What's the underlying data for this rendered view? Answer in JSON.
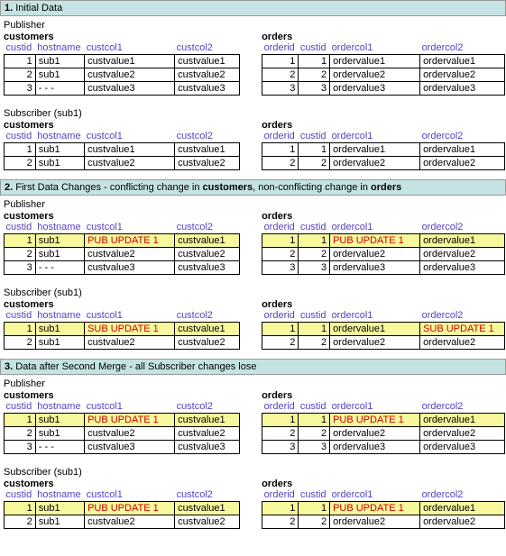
{
  "sections": [
    {
      "num": "1.",
      "title": "Initial Data",
      "roles": [
        {
          "label": "Publisher",
          "customers": {
            "title": "customers",
            "headers": [
              "custid",
              "hostname",
              "custcol1",
              "custcol2"
            ],
            "rows": [
              {
                "c": [
                  "1",
                  "sub1",
                  "custvalue1",
                  "custvalue1"
                ]
              },
              {
                "c": [
                  "2",
                  "sub1",
                  "custvalue2",
                  "custvalue2"
                ]
              },
              {
                "c": [
                  "3",
                  "- - -",
                  "custvalue3",
                  "custvalue3"
                ]
              }
            ]
          },
          "orders": {
            "title": "orders",
            "headers": [
              "orderid",
              "custid",
              "ordercol1",
              "ordercol2"
            ],
            "rows": [
              {
                "c": [
                  "1",
                  "1",
                  "ordervalue1",
                  "ordervalue1"
                ]
              },
              {
                "c": [
                  "2",
                  "2",
                  "ordervalue2",
                  "ordervalue2"
                ]
              },
              {
                "c": [
                  "3",
                  "3",
                  "ordervalue3",
                  "ordervalue3"
                ]
              }
            ]
          }
        },
        {
          "label": "Subscriber (sub1)",
          "customers": {
            "title": "customers",
            "headers": [
              "custid",
              "hostname",
              "custcol1",
              "custcol2"
            ],
            "rows": [
              {
                "c": [
                  "1",
                  "sub1",
                  "custvalue1",
                  "custvalue1"
                ]
              },
              {
                "c": [
                  "2",
                  "sub1",
                  "custvalue2",
                  "custvalue2"
                ]
              }
            ]
          },
          "orders": {
            "title": "orders",
            "headers": [
              "orderid",
              "custid",
              "ordercol1",
              "ordercol2"
            ],
            "rows": [
              {
                "c": [
                  "1",
                  "1",
                  "ordervalue1",
                  "ordervalue1"
                ]
              },
              {
                "c": [
                  "2",
                  "2",
                  "ordervalue2",
                  "ordervalue2"
                ]
              }
            ]
          }
        }
      ]
    },
    {
      "num": "2.",
      "title_html": "First Data Changes - conflicting change in <b>customers</b>, non-conflicting change in <b>orders</b>",
      "roles": [
        {
          "label": "Publisher",
          "customers": {
            "title": "customers",
            "headers": [
              "custid",
              "hostname",
              "custcol1",
              "custcol2"
            ],
            "rows": [
              {
                "c": [
                  "1",
                  "sub1",
                  "PUB UPDATE 1",
                  "custvalue1"
                ],
                "hl": true,
                "upd": [
                  2
                ]
              },
              {
                "c": [
                  "2",
                  "sub1",
                  "custvalue2",
                  "custvalue2"
                ]
              },
              {
                "c": [
                  "3",
                  "- - -",
                  "custvalue3",
                  "custvalue3"
                ]
              }
            ]
          },
          "orders": {
            "title": "orders",
            "headers": [
              "orderid",
              "custid",
              "ordercol1",
              "ordercol2"
            ],
            "rows": [
              {
                "c": [
                  "1",
                  "1",
                  "PUB UPDATE 1",
                  "ordervalue1"
                ],
                "hl": true,
                "upd": [
                  2
                ]
              },
              {
                "c": [
                  "2",
                  "2",
                  "ordervalue2",
                  "ordervalue2"
                ]
              },
              {
                "c": [
                  "3",
                  "3",
                  "ordervalue3",
                  "ordervalue3"
                ]
              }
            ]
          }
        },
        {
          "label": "Subscriber (sub1)",
          "customers": {
            "title": "customers",
            "headers": [
              "custid",
              "hostname",
              "custcol1",
              "custcol2"
            ],
            "rows": [
              {
                "c": [
                  "1",
                  "sub1",
                  "SUB UPDATE 1",
                  "custvalue1"
                ],
                "hl": true,
                "upd": [
                  2
                ]
              },
              {
                "c": [
                  "2",
                  "sub1",
                  "custvalue2",
                  "custvalue2"
                ]
              }
            ]
          },
          "orders": {
            "title": "orders",
            "headers": [
              "orderid",
              "custid",
              "ordercol1",
              "ordercol2"
            ],
            "rows": [
              {
                "c": [
                  "1",
                  "1",
                  "ordervalue1",
                  "SUB UPDATE 1"
                ],
                "hl": true,
                "upd": [
                  3
                ]
              },
              {
                "c": [
                  "2",
                  "2",
                  "ordervalue2",
                  "ordervalue2"
                ]
              }
            ]
          }
        }
      ]
    },
    {
      "num": "3.",
      "title": "Data after Second Merge - all Subscriber changes lose",
      "roles": [
        {
          "label": "Publisher",
          "customers": {
            "title": "customers",
            "headers": [
              "custid",
              "hostname",
              "custcol1",
              "custcol2"
            ],
            "rows": [
              {
                "c": [
                  "1",
                  "sub1",
                  "PUB UPDATE 1",
                  "custvalue1"
                ],
                "hl": true,
                "upd": [
                  2
                ]
              },
              {
                "c": [
                  "2",
                  "sub1",
                  "custvalue2",
                  "custvalue2"
                ]
              },
              {
                "c": [
                  "3",
                  "- - -",
                  "custvalue3",
                  "custvalue3"
                ]
              }
            ]
          },
          "orders": {
            "title": "orders",
            "headers": [
              "orderid",
              "custid",
              "ordercol1",
              "ordercol2"
            ],
            "rows": [
              {
                "c": [
                  "1",
                  "1",
                  "PUB UPDATE 1",
                  "ordervalue1"
                ],
                "hl": true,
                "upd": [
                  2
                ]
              },
              {
                "c": [
                  "2",
                  "2",
                  "ordervalue2",
                  "ordervalue2"
                ]
              },
              {
                "c": [
                  "3",
                  "3",
                  "ordervalue3",
                  "ordervalue3"
                ]
              }
            ]
          }
        },
        {
          "label": "Subscriber (sub1)",
          "customers": {
            "title": "customers",
            "headers": [
              "custid",
              "hostname",
              "custcol1",
              "custcol2"
            ],
            "rows": [
              {
                "c": [
                  "1",
                  "sub1",
                  "PUB UPDATE 1",
                  "custvalue1"
                ],
                "hl": true,
                "upd": [
                  2
                ]
              },
              {
                "c": [
                  "2",
                  "sub1",
                  "custvalue2",
                  "custvalue2"
                ]
              }
            ]
          },
          "orders": {
            "title": "orders",
            "headers": [
              "orderid",
              "custid",
              "ordercol1",
              "ordercol2"
            ],
            "rows": [
              {
                "c": [
                  "1",
                  "1",
                  "PUB UPDATE 1",
                  "ordervalue1"
                ],
                "hl": true,
                "upd": [
                  2
                ]
              },
              {
                "c": [
                  "2",
                  "2",
                  "ordervalue2",
                  "ordervalue2"
                ]
              }
            ]
          }
        }
      ]
    }
  ]
}
